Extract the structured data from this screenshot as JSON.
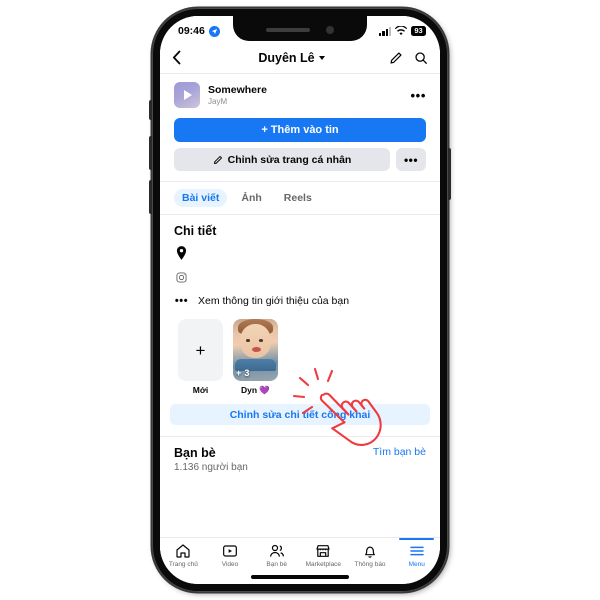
{
  "status_bar": {
    "time": "09:46",
    "location_icon": "location-arrow-icon",
    "battery": "93",
    "signal_icon": "signal-bars-icon",
    "wifi_icon": "wifi-icon"
  },
  "nav": {
    "back_icon": "chevron-left-icon",
    "title": "Duyên Lê",
    "caret_icon": "chevron-down-icon",
    "edit_icon": "pencil-icon",
    "search_icon": "search-icon"
  },
  "music": {
    "title": "Somewhere",
    "artist": "JayM",
    "play_icon": "play-icon",
    "more_label": "•••"
  },
  "actions": {
    "add_story_label": "+ Thêm vào tin",
    "edit_profile_label": "Chỉnh sửa trang cá nhân",
    "edit_profile_icon": "pencil-icon",
    "more_label": "•••"
  },
  "tabs": [
    {
      "label": "Bài viết",
      "active": true
    },
    {
      "label": "Ảnh",
      "active": false
    },
    {
      "label": "Reels",
      "active": false
    }
  ],
  "details": {
    "heading": "Chi tiết",
    "rows": [
      {
        "icon": "location-pin-icon",
        "text": ""
      },
      {
        "icon": "instagram-icon",
        "text": ""
      },
      {
        "icon": "ellipsis-icon",
        "text": "Xem thông tin giới thiệu của bạn"
      }
    ]
  },
  "highlights": [
    {
      "type": "new",
      "plus": "+",
      "label": "Mới",
      "badge": ""
    },
    {
      "type": "photo",
      "label": "Dyn 💜",
      "badge": "+ 3"
    }
  ],
  "edit_public": {
    "label": "Chỉnh sửa chi tiết công khai"
  },
  "friends": {
    "title": "Bạn bè",
    "count": "1.136 người bạn",
    "link": "Tìm bạn bè"
  },
  "bottom_nav": [
    {
      "icon": "home-icon",
      "label": "Trang chủ",
      "active": false
    },
    {
      "icon": "video-icon",
      "label": "Video",
      "active": false
    },
    {
      "icon": "friends-icon",
      "label": "Bạn bè",
      "active": false
    },
    {
      "icon": "marketplace-icon",
      "label": "Marketplace",
      "active": false
    },
    {
      "icon": "bell-icon",
      "label": "Thông báo",
      "active": false
    },
    {
      "icon": "menu-icon",
      "label": "Menu",
      "active": true
    }
  ],
  "annotation": {
    "cursor_icon": "tap-hand-cursor-icon",
    "color": "#ef3b40"
  },
  "colors": {
    "brand_blue": "#1877f2",
    "light_blue": "#e7f3ff",
    "gray_button": "#e4e6eb",
    "text_secondary": "#65676b"
  }
}
